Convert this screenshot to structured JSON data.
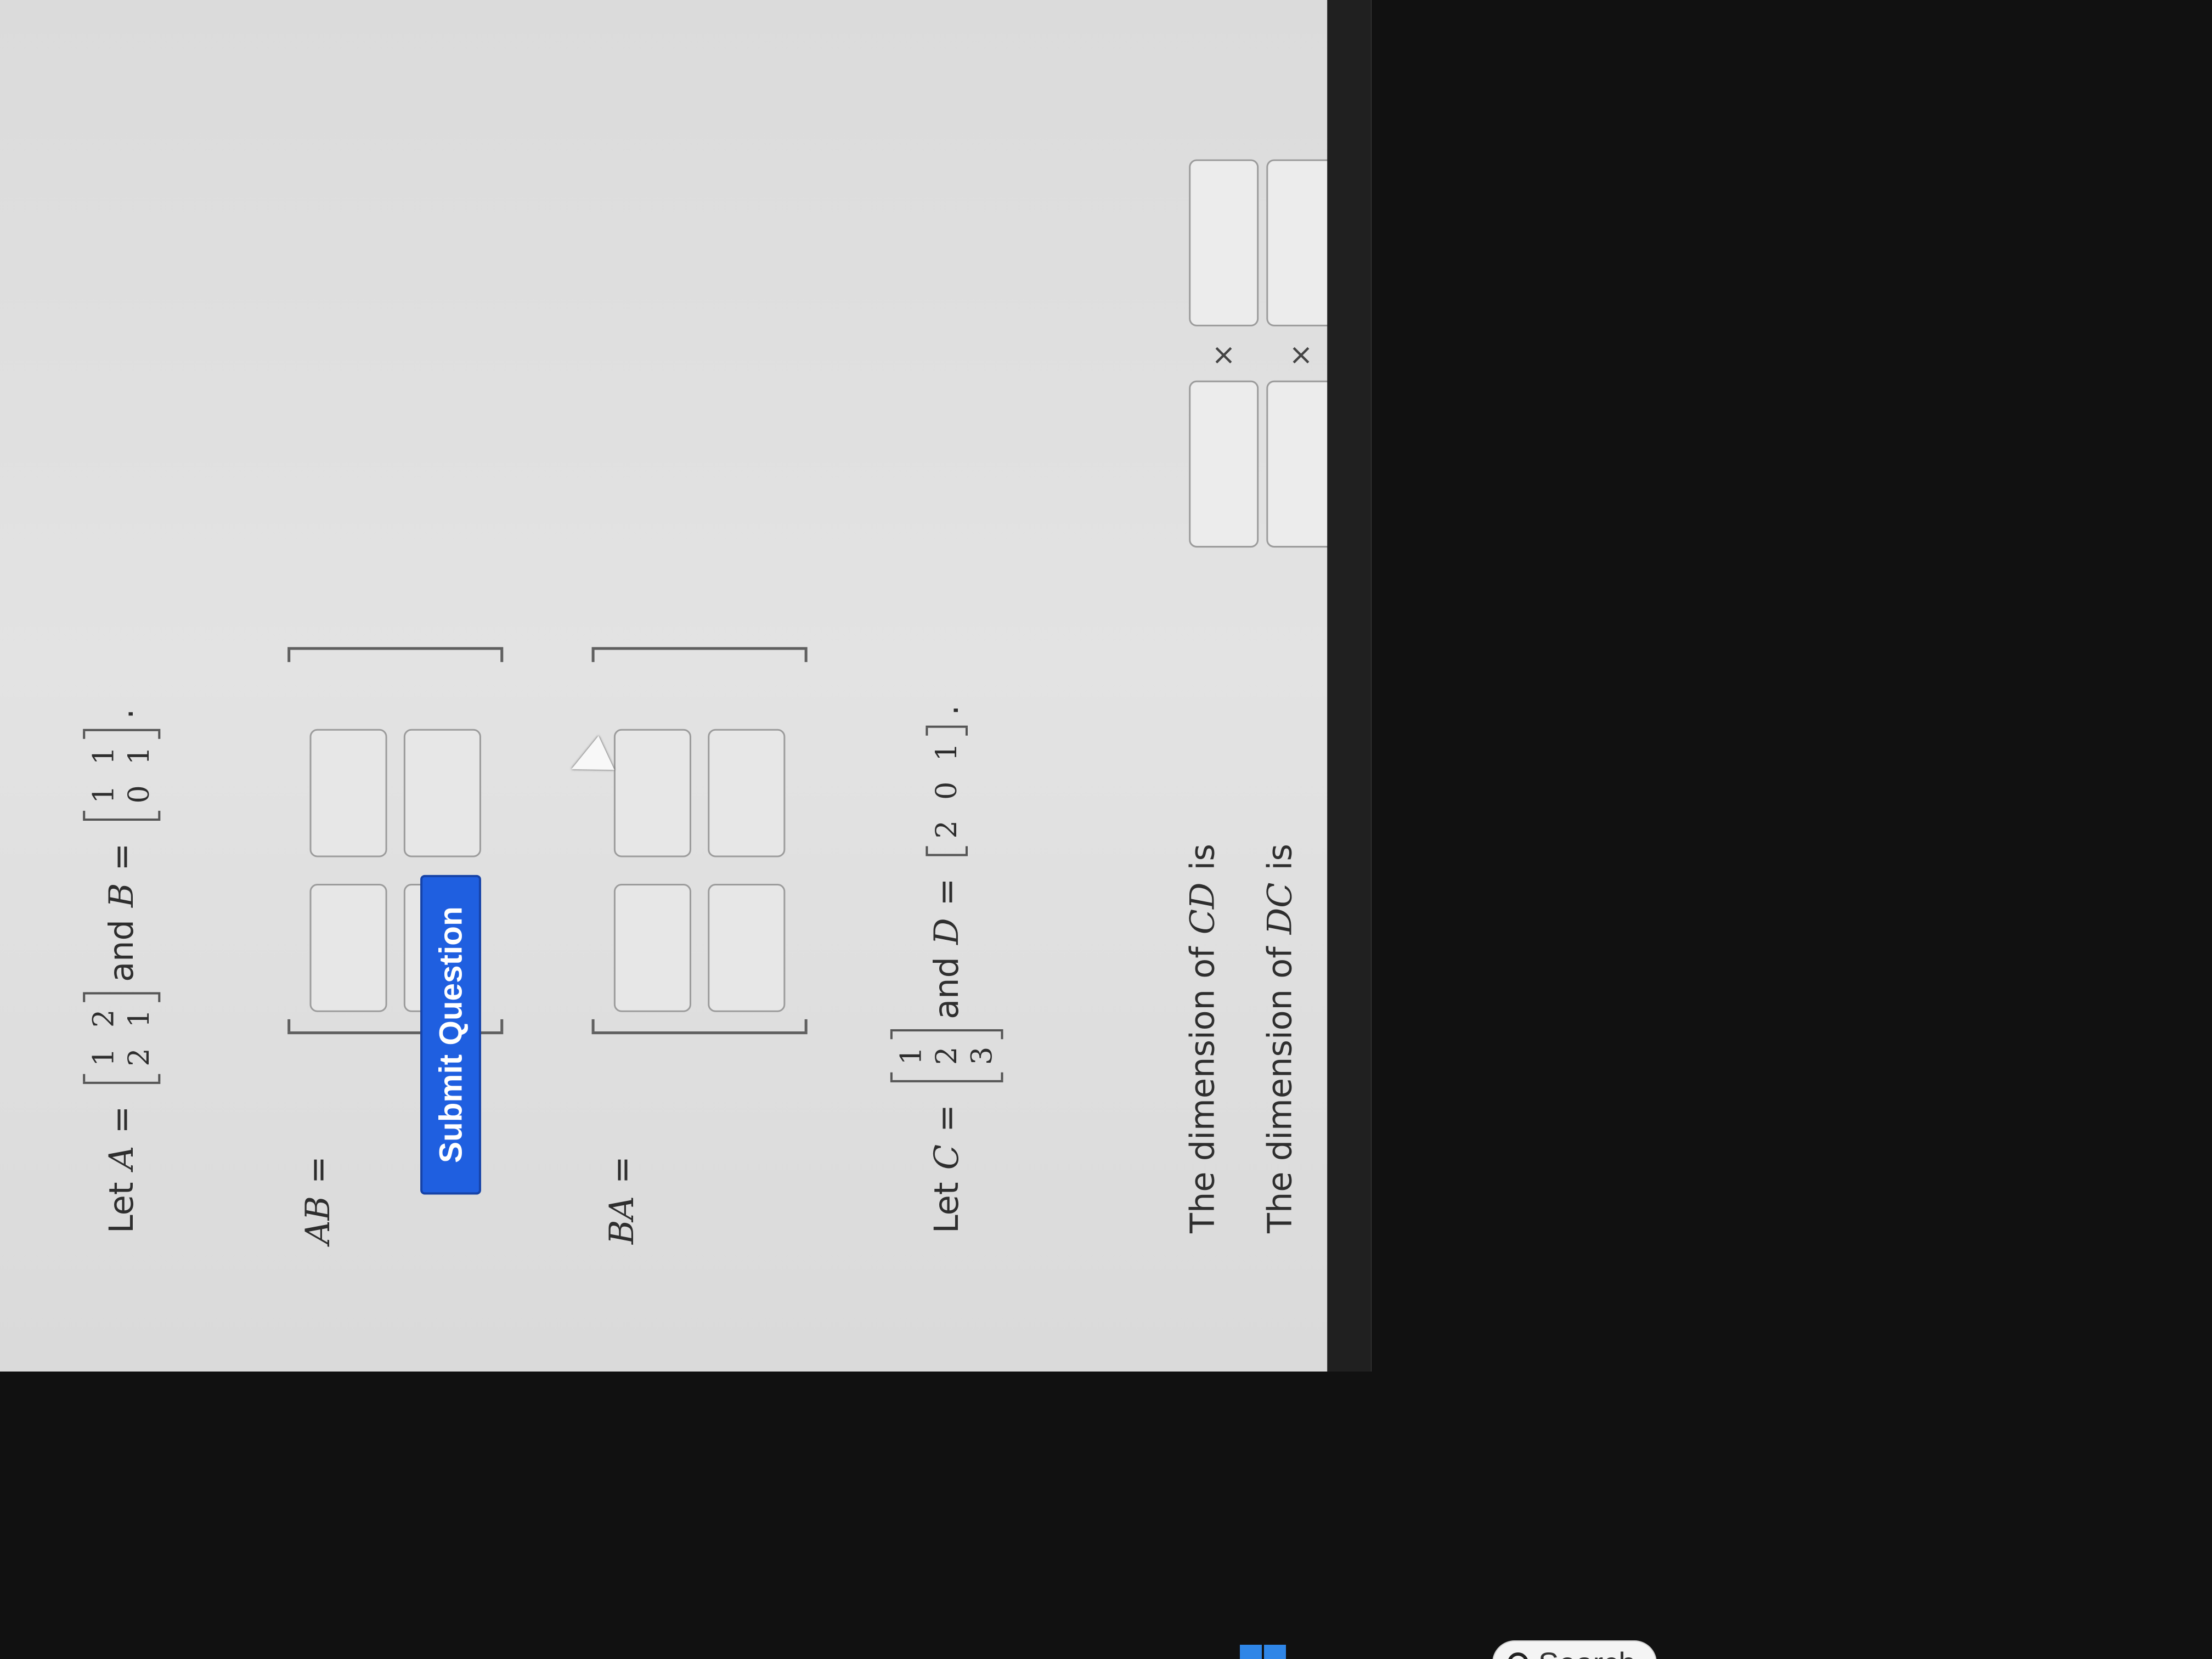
{
  "problem": {
    "intro_prefix": "Let",
    "matrix_a_name": "A",
    "equals": "=",
    "matrix_a": [
      [
        "1",
        "2"
      ],
      [
        "2",
        "1"
      ]
    ],
    "and_text": "and",
    "matrix_b_name": "B",
    "matrix_b": [
      [
        "1",
        "1"
      ],
      [
        "0",
        "1"
      ]
    ],
    "period": ".",
    "ab_label": "AB",
    "ba_label": "BA"
  },
  "vector_section": {
    "prefix": "Let",
    "c_name": "C",
    "c_values": [
      "1",
      "2",
      "3"
    ],
    "and_text": "and",
    "d_name": "D",
    "d_values": [
      "2",
      "0",
      "1"
    ],
    "period": "."
  },
  "dimension_questions": [
    {
      "prefix": "The dimension of",
      "expr": "CD",
      "suffix": "is",
      "times": "×"
    },
    {
      "prefix": "The dimension of",
      "expr": "DC",
      "suffix": "is",
      "times": "×"
    }
  ],
  "actions": {
    "submit_label": "Submit Question"
  },
  "taskbar": {
    "search_label": "Search"
  },
  "colors": {
    "submit_bg": "#1f5fe0",
    "windows_blue": "#2f86e7"
  }
}
